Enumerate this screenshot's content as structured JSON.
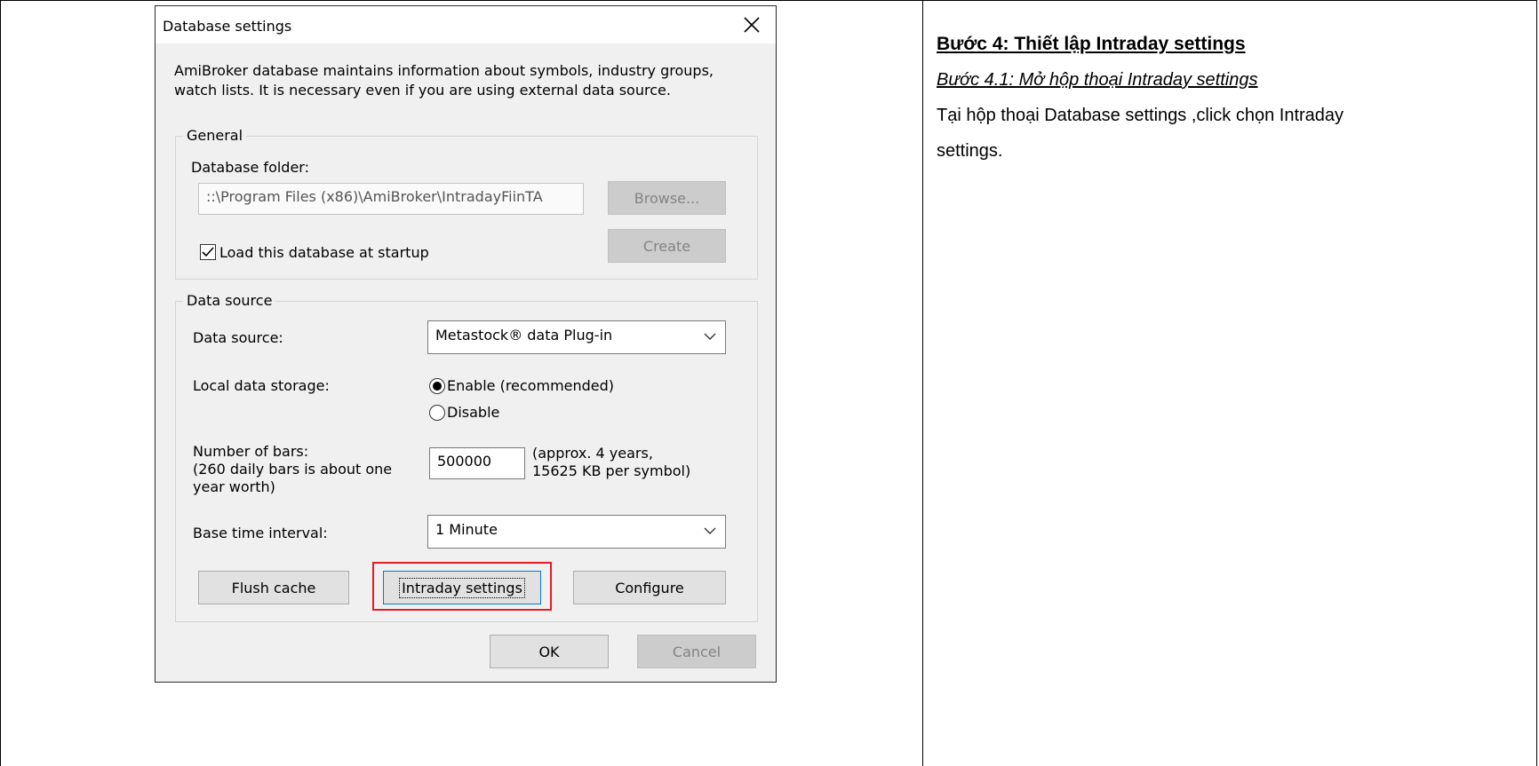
{
  "dialog": {
    "title": "Database settings",
    "close_symbol": "✕",
    "description": "AmiBroker database maintains information about symbols, industry groups, watch lists. It is necessary even if you are using external data source.",
    "general": {
      "group_label": "General",
      "folder_label": "Database folder:",
      "folder_value": "::\\Program Files (x86)\\AmiBroker\\IntradayFiinTA",
      "browse_label": "Browse...",
      "create_label": "Create",
      "load_startup_label": "Load this database at startup",
      "load_startup_checked": true
    },
    "data_source": {
      "group_label": "Data source",
      "source_label": "Data source:",
      "source_value": "Metastock® data Plug-in",
      "storage_label": "Local data storage:",
      "enable_label": "Enable (recommended)",
      "disable_label": "Disable",
      "storage_selected": "Enable (recommended)",
      "bars_label_1": "Number of bars:",
      "bars_label_2": "(260 daily bars is about one",
      "bars_label_3": "year worth)",
      "bars_value": "500000",
      "bars_info_1": "(approx. 4 years,",
      "bars_info_2": "15625 KB per symbol)",
      "interval_label": "Base time interval:",
      "interval_value": "1 Minute",
      "flush_label": "Flush cache",
      "intraday_label": "Intraday settings",
      "configure_label": "Configure"
    },
    "ok_label": "OK",
    "cancel_label": "Cancel",
    "highlight_color": "#e31b23"
  },
  "instructions": {
    "heading": "Bước 4: Thiết lập Intraday settings",
    "subheading": "Bước 4.1: Mở hộp thoại Intraday settings",
    "body": "Tại hộp thoại Database settings ,click chọn Intraday settings."
  }
}
